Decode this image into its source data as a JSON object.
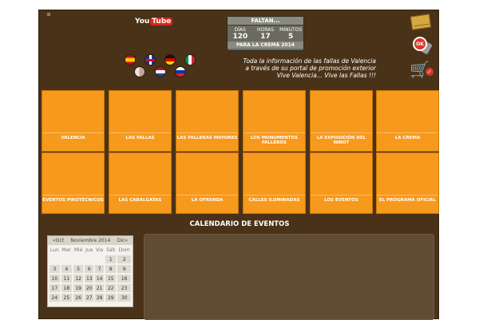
{
  "header": {
    "youtube": {
      "you": "You",
      "tube": "Tube"
    },
    "countdown": {
      "title": "FALTAN...",
      "labels": [
        "DÍAS",
        "HORAS",
        "MINUTOS"
      ],
      "values": [
        "120",
        "17",
        "5"
      ],
      "footer": "PARA LA CREMÁ 2014"
    },
    "languages": [
      "es-flag-icon",
      "uk-flag-icon",
      "de-flag-icon",
      "it-flag-icon",
      "fi-flag-icon",
      "nl-flag-icon",
      "ru-flag-icon"
    ],
    "tagline": [
      "Toda la información de las fallas de Valencia",
      "a través de su portal de promoción exterior",
      "Vive Valencia... Vive las Fallas !!!"
    ],
    "icons": [
      "envelope-icon",
      "badge-icon",
      "cart-icon"
    ]
  },
  "tiles": [
    "VALENCIA",
    "LAS FALLAS",
    "LAS FALLERAS MAYORES",
    "LOS MONUMENTOS FALLEROS",
    "LA EXPOSICIÓN DEL NINOT",
    "LA CREMA",
    "EVENTOS PIROTÉCNICOS",
    "LAS CABALGATAS",
    "LA OFRENDA",
    "CALLES ILUMINADAS",
    "LOS EVENTOS",
    "EL PROGRAMA OFICIAL"
  ],
  "calendar": {
    "title": "CALENDARIO DE EVENTOS",
    "prev": "«Oct",
    "month": "Noviembre 2014",
    "next": "Dic»",
    "weekdays": [
      "Lun",
      "Mar",
      "Mié",
      "Jue",
      "Vie",
      "Sáb",
      "Dom"
    ],
    "weeks": [
      [
        "",
        "",
        "",
        "",
        "",
        "1",
        "2"
      ],
      [
        "3",
        "4",
        "5",
        "6",
        "7",
        "8",
        "9"
      ],
      [
        "10",
        "11",
        "12",
        "13",
        "14",
        "15",
        "16"
      ],
      [
        "17",
        "18",
        "19",
        "20",
        "21",
        "22",
        "23"
      ],
      [
        "24",
        "25",
        "26",
        "27",
        "28",
        "29",
        "30"
      ]
    ]
  },
  "colors": {
    "background": "#4a3219",
    "tile": "#f7991c",
    "accent": "#d8261c"
  }
}
